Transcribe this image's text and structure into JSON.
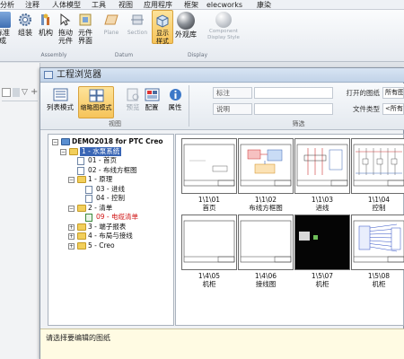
{
  "menu": [
    "分析",
    "注释",
    "人体模型",
    "工具",
    "视图",
    "应用程序",
    "框架",
    "elecworks",
    "康染"
  ],
  "ribbon": {
    "buttons": [
      {
        "label": "标准\n成",
        "icon": "ribbon-icon-standard"
      },
      {
        "label": "组装",
        "icon": "gear-assembly-icon"
      },
      {
        "label": "机构",
        "icon": "mechanism-icon"
      },
      {
        "label": "拖动\n元件",
        "icon": "drag-component-icon"
      },
      {
        "label": "元件\n界面",
        "icon": "component-interface-icon"
      },
      {
        "label": "Plane",
        "icon": "plane-icon"
      },
      {
        "label": "Section",
        "icon": "section-icon"
      },
      {
        "label": "显示\n样式",
        "icon": "display-style-icon"
      },
      {
        "label": "外观库",
        "icon": "appearance-gallery-icon"
      },
      {
        "label": "Component\nDisplay Style",
        "icon": "component-display-icon"
      }
    ],
    "groups": [
      "Assembly",
      "Datum",
      "Display"
    ]
  },
  "dialog": {
    "title": "工程浏览器",
    "toolbar": [
      {
        "label": "列表模式",
        "icon": "list-view-icon"
      },
      {
        "label": "缩略图模式",
        "icon": "thumbnail-view-icon"
      },
      {
        "label": "预览",
        "icon": "preview-icon"
      },
      {
        "label": "配置",
        "icon": "config-icon"
      },
      {
        "label": "属性",
        "icon": "info-icon"
      }
    ],
    "view_group_label": "视图",
    "filter_group_label": "筛选",
    "fields": {
      "tag_label": "标注",
      "note_label": "说明",
      "open_label": "打开的图纸",
      "open_value": "所有图",
      "filetype_label": "文件类型",
      "filetype_value": "<所有"
    },
    "tree": [
      {
        "text": "DEMO2018 for PTC Creo",
        "level": 0,
        "kind": "project",
        "toggle": "−",
        "bold": true
      },
      {
        "text": "1 - 水泵系统",
        "level": 1,
        "kind": "folder-open",
        "toggle": "−",
        "selected": true
      },
      {
        "text": "01 - 首页",
        "level": 2,
        "kind": "doc"
      },
      {
        "text": "02 - 布线方框图",
        "level": 2,
        "kind": "doc"
      },
      {
        "text": "1 - 原理",
        "level": 2,
        "kind": "folder",
        "toggle": "−"
      },
      {
        "text": "03 - 进线",
        "level": 3,
        "kind": "doc"
      },
      {
        "text": "04 - 控制",
        "level": 3,
        "kind": "doc"
      },
      {
        "text": "2 - 清单",
        "level": 2,
        "kind": "folder",
        "toggle": "−"
      },
      {
        "text": "09 - 电缆清单",
        "level": 3,
        "kind": "list",
        "red": true
      },
      {
        "text": "3 - 端子报表",
        "level": 2,
        "kind": "folder",
        "toggle": "+"
      },
      {
        "text": "4 - 布局与接线",
        "level": 2,
        "kind": "folder",
        "toggle": "+"
      },
      {
        "text": "5 - Creo",
        "level": 2,
        "kind": "folder",
        "toggle": "+"
      }
    ],
    "thumbnails": [
      {
        "id": "1\\1\\01",
        "name": "首页",
        "style": "cover"
      },
      {
        "id": "1\\1\\02",
        "name": "布线方框图",
        "style": "block"
      },
      {
        "id": "1\\1\\03",
        "name": "进线",
        "style": "schematic"
      },
      {
        "id": "1\\1\\04",
        "name": "控制",
        "style": "control"
      },
      {
        "id": "1\\4\\05",
        "name": "机柜",
        "style": "blank"
      },
      {
        "id": "1\\4\\06",
        "name": "接线图",
        "style": "blank"
      },
      {
        "id": "1\\5\\07",
        "name": "机柜",
        "style": "black"
      },
      {
        "id": "1\\5\\08",
        "name": "机柜",
        "style": "wiring"
      }
    ],
    "status_text": "请选择要编辑的图纸"
  }
}
